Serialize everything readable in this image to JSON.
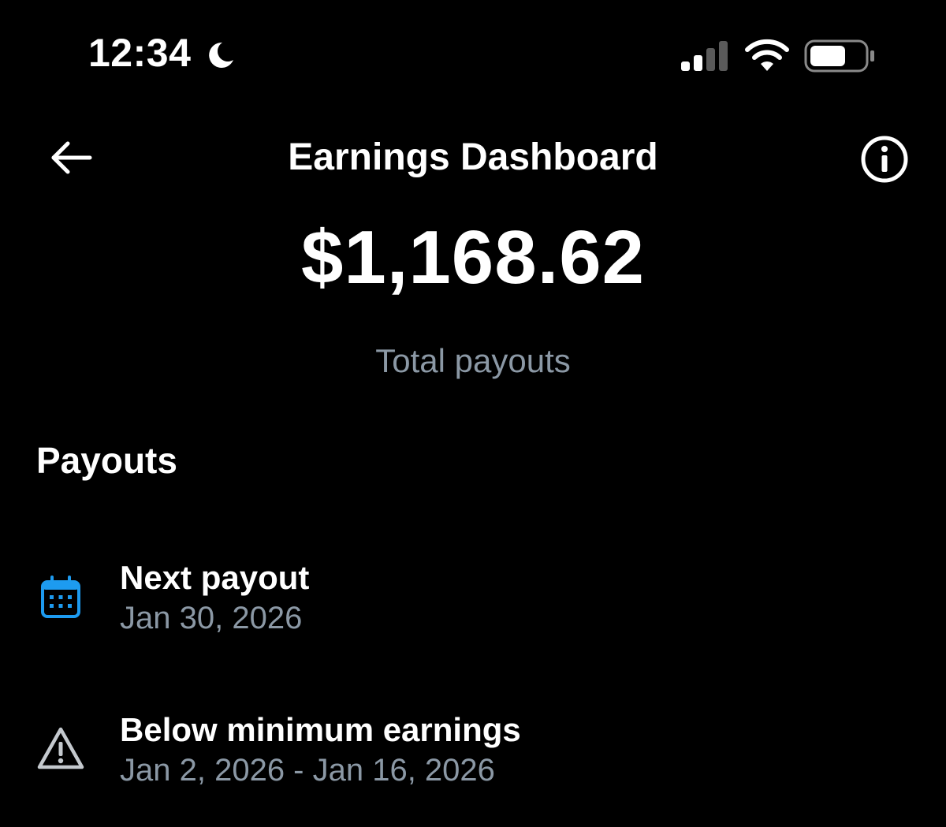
{
  "status_bar": {
    "time": "12:34",
    "focus_icon": "moon-icon",
    "signal_icon": "cellular-signal-icon",
    "wifi_icon": "wifi-icon",
    "battery_icon": "battery-icon"
  },
  "header": {
    "back_icon": "arrow-left-icon",
    "title": "Earnings Dashboard",
    "info_icon": "info-circle-icon"
  },
  "summary": {
    "amount": "$1,168.62",
    "label": "Total payouts"
  },
  "payouts": {
    "section_title": "Payouts",
    "items": [
      {
        "icon": "calendar-icon",
        "title": "Next payout",
        "subtitle": "Jan 30, 2026"
      },
      {
        "icon": "warning-icon",
        "title": "Below minimum earnings",
        "subtitle": "Jan 2, 2026 - Jan 16, 2026"
      }
    ]
  },
  "colors": {
    "background": "#000000",
    "text_primary": "#ffffff",
    "text_secondary": "#8b98a5",
    "accent": "#1d9bf0"
  }
}
